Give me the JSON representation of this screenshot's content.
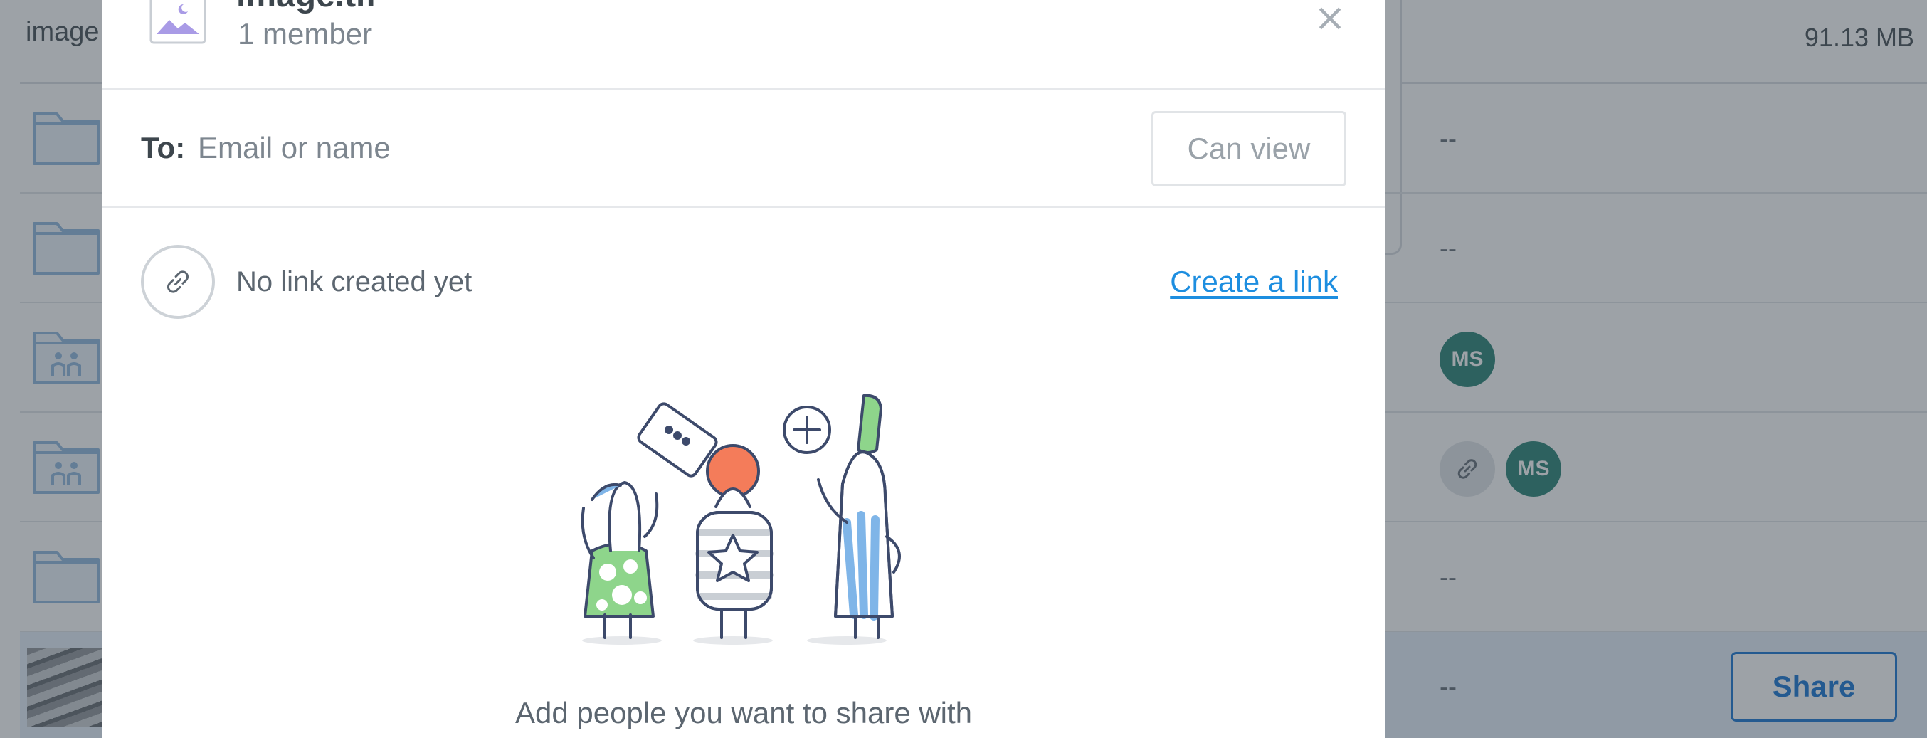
{
  "background": {
    "header": {
      "name": "image",
      "size": "91.13 MB"
    },
    "rows": [
      {
        "type": "folder",
        "modified": "--"
      },
      {
        "type": "folder",
        "modified": "--"
      },
      {
        "type": "shared-folder",
        "member": "MS"
      },
      {
        "type": "shared-folder",
        "member": "MS"
      },
      {
        "type": "folder",
        "modified": "--"
      },
      {
        "type": "image",
        "modified": "--",
        "share_label": "Share"
      }
    ]
  },
  "modal": {
    "file_name": "image.tif",
    "member_count": "1 member",
    "to_label": "To:",
    "to_placeholder": "Email or name",
    "permission": "Can view",
    "link_status": "No link created yet",
    "create_link": "Create a link",
    "empty_message": "Add people you want to share with"
  },
  "colors": {
    "accent": "#1d8ee0",
    "primary_button": "#0d6fd1",
    "avatar": "#1e7d6f",
    "overlay": "#3c4650",
    "folder_stroke": "#8ab4dd",
    "folder_fill": "#eaf3fb"
  },
  "icons": {
    "close": "close-icon",
    "link": "link-icon",
    "file": "image-file-icon",
    "folder": "folder-icon",
    "shared_folder": "shared-folder-icon"
  }
}
